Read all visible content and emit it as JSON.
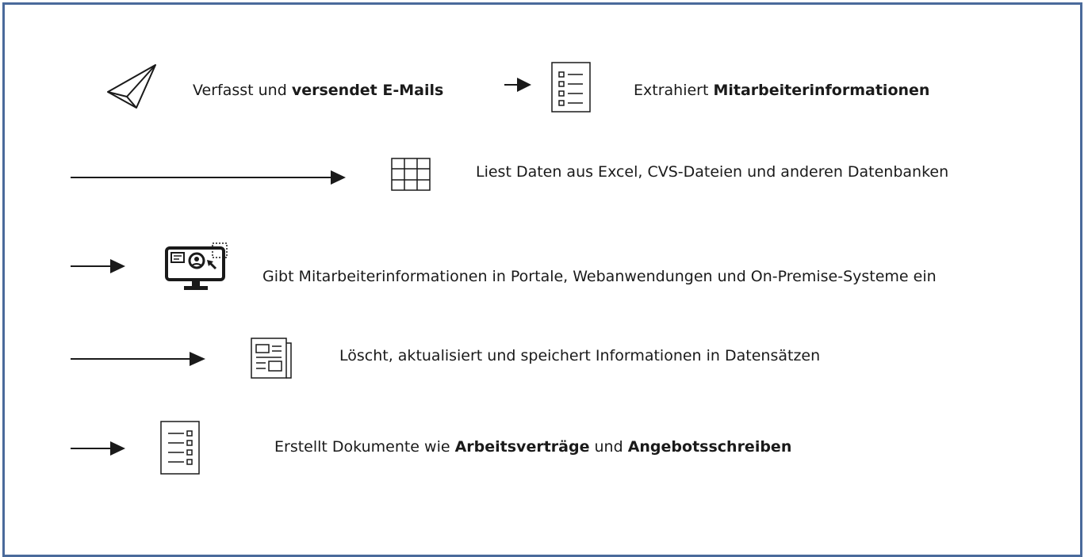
{
  "steps": [
    {
      "pre": "Verfasst und ",
      "bold": "versendet E-Mails",
      "post": ""
    },
    {
      "pre": "Extrahiert ",
      "bold": "Mitarbeiterinformationen",
      "post": ""
    },
    {
      "text": "Liest Daten aus Excel, CVS-Dateien und anderen Datenbanken"
    },
    {
      "text": "Gibt Mitarbeiterinformationen in Portale, Webanwendungen und On-Premise-Systeme ein"
    },
    {
      "text": "Löscht, aktualisiert und speichert Informationen in Datensätzen"
    },
    {
      "pre": "Erstellt Dokumente wie ",
      "bold": "Arbeitsverträge",
      "mid": " und ",
      "bold2": "Angebotsschreiben"
    }
  ],
  "colors": {
    "frame": "#4a6a9b",
    "stroke": "#1a1a1a"
  },
  "icons": [
    "paper-plane-icon",
    "checklist-icon",
    "table-grid-icon",
    "monitor-user-icon",
    "newspaper-icon",
    "document-list-icon"
  ]
}
